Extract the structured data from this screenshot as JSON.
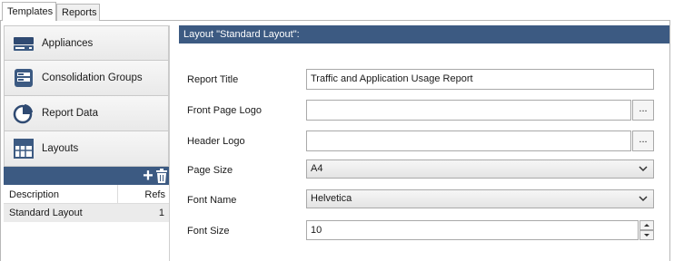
{
  "tabs": [
    {
      "label": "Templates",
      "active": true
    },
    {
      "label": "Reports",
      "active": false
    }
  ],
  "sidebar": {
    "items": [
      {
        "label": "Appliances",
        "icon": "appliance-icon"
      },
      {
        "label": "Consolidation Groups",
        "icon": "consolidation-groups-icon"
      },
      {
        "label": "Report Data",
        "icon": "pie-chart-icon"
      },
      {
        "label": "Layouts",
        "icon": "grid-layout-icon"
      }
    ],
    "layouts_table": {
      "columns": [
        "Description",
        "Refs"
      ],
      "rows": [
        {
          "description": "Standard Layout",
          "refs": "1"
        }
      ]
    }
  },
  "main": {
    "header": "Layout \"Standard Layout\":",
    "fields": {
      "report_title": {
        "label": "Report Title",
        "value": "Traffic and Application Usage Report"
      },
      "front_page_logo": {
        "label": "Front Page Logo",
        "value": "",
        "browse_label": "..."
      },
      "header_logo": {
        "label": "Header Logo",
        "value": "",
        "browse_label": "..."
      },
      "page_size": {
        "label": "Page Size",
        "value": "A4"
      },
      "font_name": {
        "label": "Font Name",
        "value": "Helvetica"
      },
      "font_size": {
        "label": "Font Size",
        "value": "10"
      }
    }
  },
  "colors": {
    "header_blue": "#3c5a82",
    "selected_row": "#ebebeb"
  }
}
